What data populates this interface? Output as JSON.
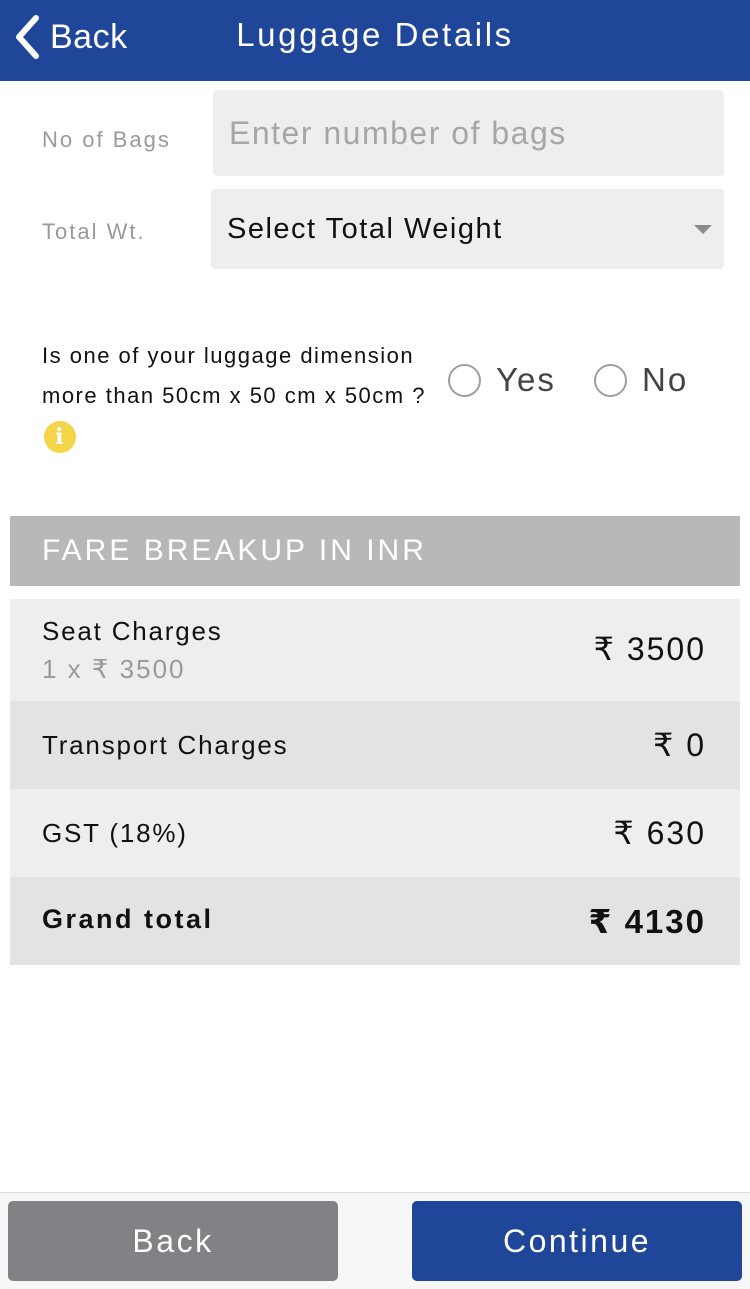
{
  "header": {
    "back_label": "Back",
    "title": "Luggage Details"
  },
  "form": {
    "bags_label": "No of Bags",
    "bags_placeholder": "Enter number of bags",
    "bags_value": "",
    "weight_label": "Total Wt.",
    "weight_value": "Select Total Weight"
  },
  "dimension_question": {
    "text": "Is one of your luggage dimension more than 50cm x 50 cm x 50cm ?",
    "options": [
      "Yes",
      "No"
    ],
    "selected": null
  },
  "fare": {
    "title": "FARE BREAKUP IN INR",
    "rows": [
      {
        "name": "Seat Charges",
        "detail": "1 x ₹ 3500",
        "amount": "₹ 3500"
      },
      {
        "name": "Transport Charges",
        "amount": "₹ 0"
      },
      {
        "name": "GST (18%)",
        "amount": "₹ 630"
      }
    ],
    "total": {
      "name": "Grand total",
      "amount": "₹ 4130"
    }
  },
  "footer": {
    "back_label": "Back",
    "continue_label": "Continue"
  },
  "colors": {
    "primary": "#1f4699",
    "secondary_button": "#808285",
    "section_header": "#b8b8b8",
    "info_icon": "#f4d547"
  }
}
